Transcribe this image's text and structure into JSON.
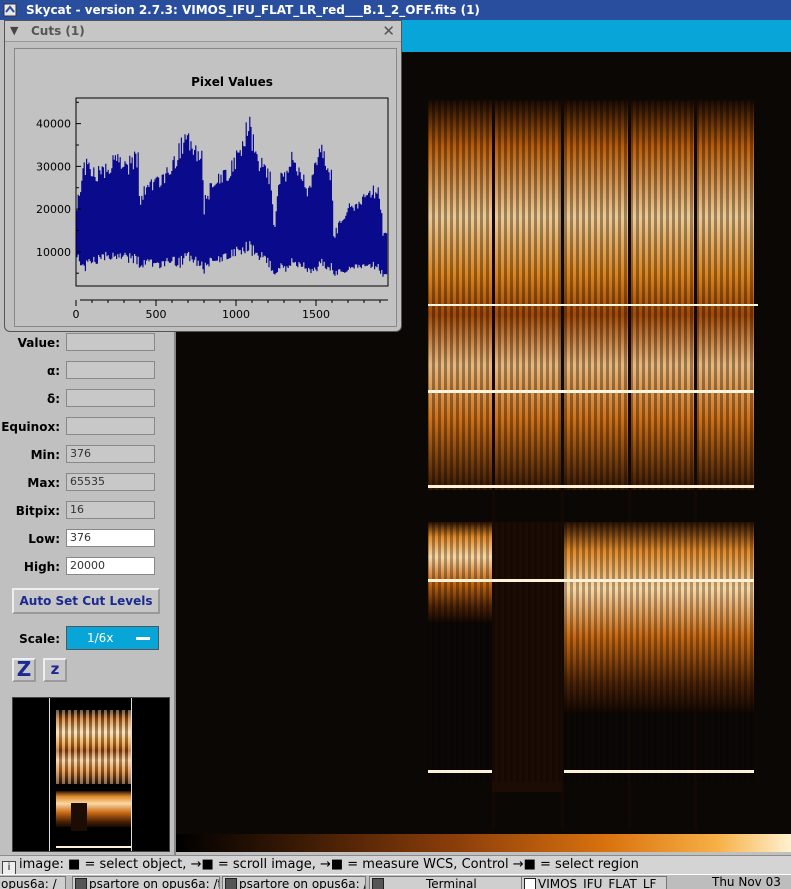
{
  "window": {
    "title": "Skycat - version 2.7.3: VIMOS_IFU_FLAT_LR_red___B.1_2_OFF.fits (1)"
  },
  "cuts_window": {
    "title": "Cuts (1)",
    "close_icon": "close-icon",
    "menu_icon": "chevron-down-icon"
  },
  "chart_data": {
    "type": "line",
    "title": "Pixel Values",
    "xlabel": "",
    "ylabel": "",
    "xlim": [
      0,
      1950
    ],
    "ylim": [
      2000,
      46000
    ],
    "xticks": [
      "0",
      "500",
      "1000",
      "1500"
    ],
    "yticks": [
      "10000",
      "20000",
      "30000",
      "40000"
    ],
    "series": [
      {
        "color": "#0a0a8c",
        "x": [
          0,
          50,
          100,
          150,
          200,
          250,
          300,
          350,
          390,
          400,
          410,
          450,
          500,
          550,
          600,
          650,
          700,
          750,
          790,
          800,
          810,
          850,
          900,
          950,
          1000,
          1050,
          1080,
          1100,
          1150,
          1200,
          1220,
          1240,
          1260,
          1300,
          1350,
          1400,
          1450,
          1500,
          1550,
          1600,
          1610,
          1650,
          1700,
          1750,
          1800,
          1850,
          1900,
          1920
        ],
        "upper": [
          20000,
          33000,
          31000,
          30000,
          31000,
          34000,
          32000,
          33000,
          35000,
          20000,
          25000,
          27000,
          29000,
          29000,
          32000,
          37000,
          38000,
          35000,
          34000,
          20000,
          24000,
          27000,
          29000,
          30000,
          34000,
          38000,
          44000,
          39000,
          33000,
          31000,
          28000,
          15000,
          27000,
          30000,
          34000,
          31000,
          26000,
          35000,
          36000,
          29000,
          14000,
          18000,
          22000,
          22000,
          25000,
          26000,
          25000,
          15000
        ],
        "lower": [
          9000,
          5000,
          7000,
          7000,
          8000,
          7000,
          8000,
          7000,
          7000,
          5000,
          6000,
          7000,
          6000,
          6000,
          7000,
          6000,
          7000,
          6000,
          5000,
          4000,
          6000,
          7000,
          7000,
          8000,
          9000,
          9000,
          10000,
          9000,
          8000,
          7000,
          5000,
          4000,
          5000,
          5000,
          6000,
          6000,
          5000,
          5000,
          6000,
          5000,
          4000,
          5000,
          5000,
          6000,
          6000,
          6000,
          5000,
          4000
        ]
      }
    ]
  },
  "fields": [
    {
      "label": "Value:",
      "value": ""
    },
    {
      "label": "α:",
      "value": ""
    },
    {
      "label": "δ:",
      "value": ""
    },
    {
      "label": "Equinox:",
      "value": ""
    },
    {
      "label": "Min:",
      "value": "376"
    },
    {
      "label": "Max:",
      "value": "65535"
    },
    {
      "label": "Bitpix:",
      "value": "16"
    },
    {
      "label": "Low:",
      "value": "376"
    },
    {
      "label": "High:",
      "value": "20000"
    }
  ],
  "auto_button": "Auto Set Cut Levels",
  "scale": {
    "label": "Scale:",
    "value": "1/6x"
  },
  "zoom_buttons": {
    "zoom_in": "Z",
    "zoom_out": "z"
  },
  "status_bar": {
    "prefix": "image:",
    "parts": [
      " = select object, ",
      " = scroll image, ",
      " = measure WCS, Control ",
      " = select region"
    ]
  },
  "taskbar": [
    {
      "label": "opus6a: /"
    },
    {
      "label": "psartore on opus6a: /t"
    },
    {
      "label": "psartore on opus6a: /"
    },
    {
      "label": "Terminal"
    },
    {
      "label": "VIMOS_IFU_FLAT_LF"
    },
    {
      "label": "Thu Nov 03"
    }
  ],
  "colors": {
    "title_bar": "#2a4e9e",
    "accent_cyan": "#08a6d8",
    "plot_line": "#0a0a8c",
    "image_glow": "#f3a64a"
  }
}
